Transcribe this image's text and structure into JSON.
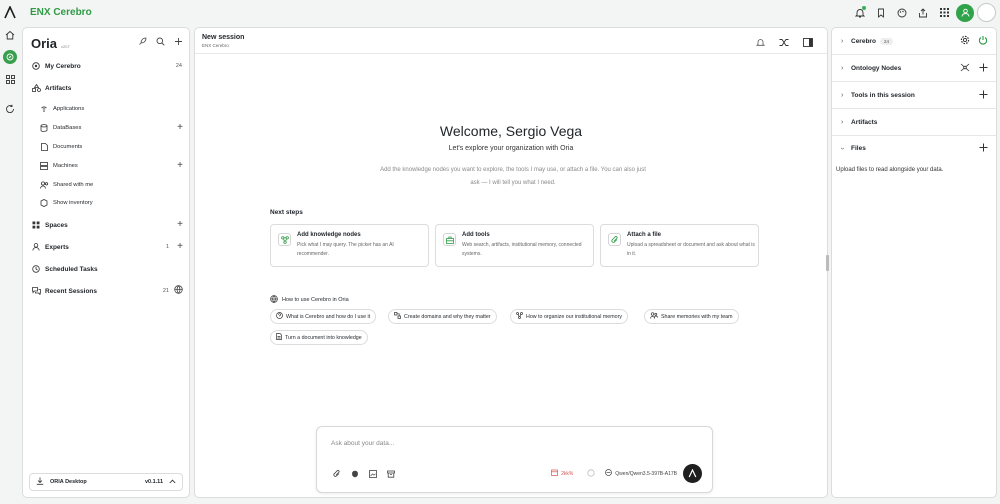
{
  "app": {
    "brand": "ENX Cerebro"
  },
  "sidebar": {
    "title": "Oria",
    "version": "v207",
    "items": [
      {
        "label": "My Cerebro",
        "count": "24"
      },
      {
        "label": "Artifacts"
      },
      {
        "label": "Applications"
      },
      {
        "label": "DataBases"
      },
      {
        "label": "Documents"
      },
      {
        "label": "Machines"
      },
      {
        "label": "Shared with me"
      },
      {
        "label": "Show inventory"
      },
      {
        "label": "Spaces"
      },
      {
        "label": "Experts",
        "count": "1"
      },
      {
        "label": "Scheduled Tasks"
      },
      {
        "label": "Recent Sessions",
        "count": "21"
      }
    ],
    "footer": {
      "label": "ORIA Desktop",
      "version": "v0.1.11"
    }
  },
  "main": {
    "title": "New session",
    "subtitle": "ENX Cerebro",
    "welcome": "Welcome, Sergio Vega",
    "tagline": "Let's explore your organization with Oria",
    "hint": "Add the knowledge nodes you want to explore, the tools I may use, or attach a file. You can also just ask — I will tell you what I need.",
    "next_steps_label": "Next steps",
    "cards": [
      {
        "title": "Add knowledge nodes",
        "desc": "Pick what I may query. The picker has an AI recommender."
      },
      {
        "title": "Add tools",
        "desc": "Web search, artifacts, institutional memory, connected systems."
      },
      {
        "title": "Attach a file",
        "desc": "Upload a spreadsheet or document and ask about what is in it."
      }
    ],
    "howto_label": "How to use Cerebro in Oria",
    "chips": [
      "What is Cerebro and how do I use it",
      "Create domains and why they matter",
      "How to organize our institutional memory",
      "Share memories with my team",
      "Turn a document into knowledge"
    ],
    "composer": {
      "placeholder": "Ask about your data...",
      "usage": "2kk%",
      "model": "Qwen/Qwen3.5-397B-A17B"
    }
  },
  "right_panel": {
    "sections": [
      {
        "label": "Cerebro",
        "count": "24"
      },
      {
        "label": "Ontology Nodes"
      },
      {
        "label": "Tools in this session"
      },
      {
        "label": "Artifacts"
      },
      {
        "label": "Files"
      }
    ],
    "files_note": "Upload files to read alongside your data."
  },
  "colors": {
    "accent": "#2f9a45",
    "usage": "#d9534f"
  }
}
